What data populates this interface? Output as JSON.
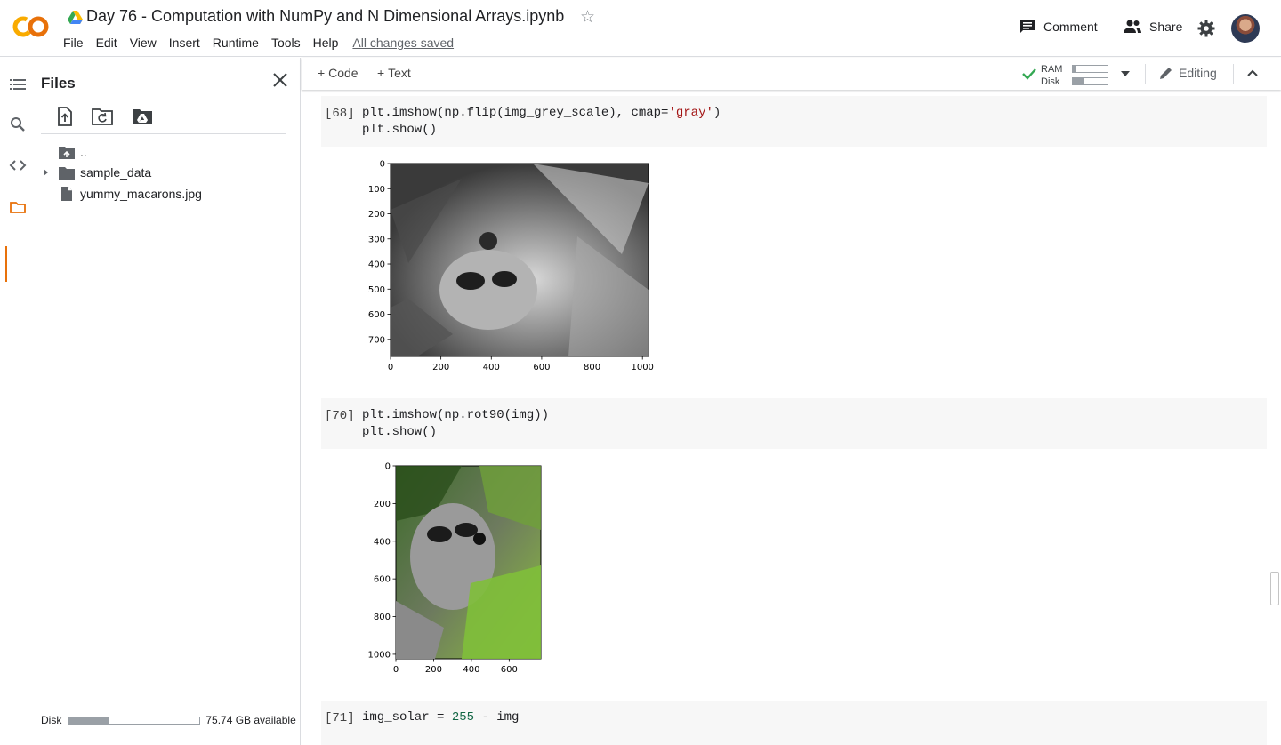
{
  "header": {
    "notebook_title": "Day 76 - Computation with NumPy and N Dimensional Arrays.ipynb",
    "menu": [
      "File",
      "Edit",
      "View",
      "Insert",
      "Runtime",
      "Tools",
      "Help"
    ],
    "save_status": "All changes saved",
    "comment_label": "Comment",
    "share_label": "Share"
  },
  "files_panel": {
    "title": "Files",
    "items": [
      {
        "name": "..",
        "type": "parent"
      },
      {
        "name": "sample_data",
        "type": "folder"
      },
      {
        "name": "yummy_macarons.jpg",
        "type": "file"
      }
    ],
    "disk_label": "Disk",
    "disk_available": "75.74 GB available",
    "disk_used_fraction": 0.3
  },
  "toolbar": {
    "add_code": "Code",
    "add_text": "Text",
    "ram_label": "RAM",
    "disk_label": "Disk",
    "ram_used_fraction": 0.08,
    "disk_used_fraction": 0.3,
    "editing_label": "Editing"
  },
  "cells": [
    {
      "number": "[68]",
      "code_line1": {
        "pre": "plt.imshow(np.flip(img_grey_scale), cmap=",
        "str": "'gray'",
        "post": ")"
      },
      "code_line2": "plt.show()",
      "plot": {
        "image": "greyscale raccoon, flipped",
        "y_ticks": [
          "0",
          "100",
          "200",
          "300",
          "400",
          "500",
          "600",
          "700"
        ],
        "x_ticks": [
          "0",
          "200",
          "400",
          "600",
          "800",
          "1000"
        ]
      }
    },
    {
      "number": "[70]",
      "code_line1": "plt.imshow(np.rot90(img))",
      "code_line2": "plt.show()",
      "plot": {
        "image": "color raccoon, rotated 90 degrees",
        "y_ticks": [
          "0",
          "200",
          "400",
          "600",
          "800",
          "1000"
        ],
        "x_ticks": [
          "0",
          "200",
          "400",
          "600"
        ]
      }
    },
    {
      "number": "[71]",
      "code_line1": {
        "pre": "img_solar = ",
        "num": "255",
        "post": " - img"
      }
    }
  ]
}
